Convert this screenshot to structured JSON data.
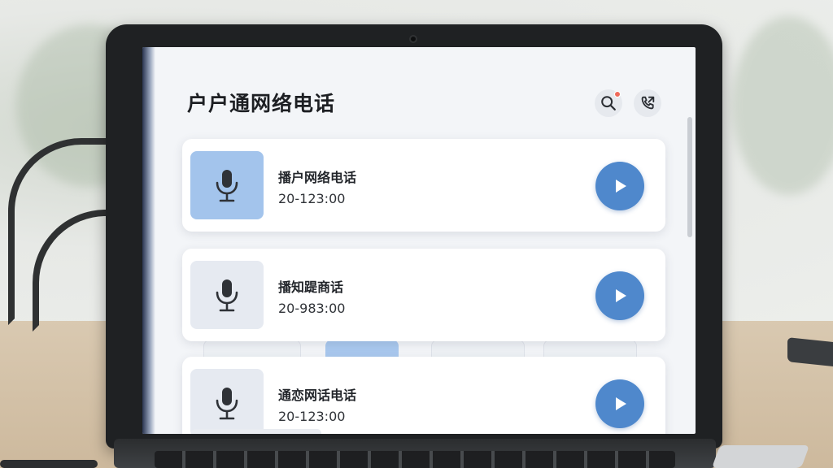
{
  "app": {
    "title": "户户通网络电话",
    "header_icons": [
      "search-icon",
      "phone-call-icon"
    ],
    "accent_color": "#4f88cc"
  },
  "calls": [
    {
      "title": "播户网络电话",
      "time": "20-123:00",
      "state": "active",
      "icon": "microphone-icon"
    },
    {
      "title": "播知踶商话",
      "time": "20-983:00",
      "state": "idle",
      "icon": "microphone-icon"
    },
    {
      "title": "通恋网话电话",
      "time": "20-123:00",
      "state": "idle",
      "icon": "microphone-icon"
    }
  ]
}
